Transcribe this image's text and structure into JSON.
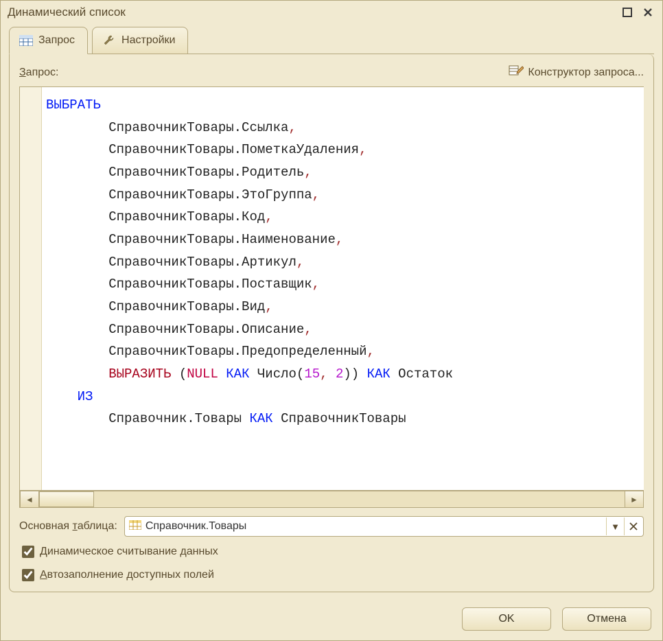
{
  "window": {
    "title": "Динамический список"
  },
  "tabs": {
    "query": "Запрос",
    "settings": "Настройки"
  },
  "labels": {
    "query": "Запрос:",
    "query_access": "З",
    "query_rest": "апрос:",
    "designer": "Конструктор запроса...",
    "main_table": "Основная таблица:",
    "main_table_pre": "Основная ",
    "main_table_access": "т",
    "main_table_post": "аблица:",
    "dyn_read": "Динамическое считывание данных",
    "dyn_access": "Д",
    "dyn_rest": "инамическое считывание данных",
    "autofill": "Автозаполнение доступных полей",
    "auto_access": "А",
    "auto_rest": "втозаполнение доступных полей"
  },
  "main_table_value": "Справочник.Товары",
  "checks": {
    "dyn_read": true,
    "autofill": true
  },
  "buttons": {
    "ok": "OK",
    "cancel": "Отмена"
  },
  "query": {
    "select": "ВЫБРАТЬ",
    "fields": [
      "СправочникТовары.Ссылка",
      "СправочникТовары.ПометкаУдаления",
      "СправочникТовары.Родитель",
      "СправочникТовары.ЭтоГруппа",
      "СправочникТовары.Код",
      "СправочникТовары.Наименование",
      "СправочникТовары.Артикул",
      "СправочникТовары.Поставщик",
      "СправочникТовары.Вид",
      "СправочникТовары.Описание",
      "СправочникТовары.Предопределенный"
    ],
    "cast_expr": {
      "func": "ВЫРАЗИТЬ",
      "null": "NULL",
      "as1": "КАК",
      "type": "Число",
      "args": [
        "15",
        "2"
      ],
      "as2": "КАК",
      "alias": "Остаток"
    },
    "from_kw": "ИЗ",
    "from_table": "Справочник.Товары",
    "from_as": "КАК",
    "from_alias": "СправочникТовары"
  }
}
